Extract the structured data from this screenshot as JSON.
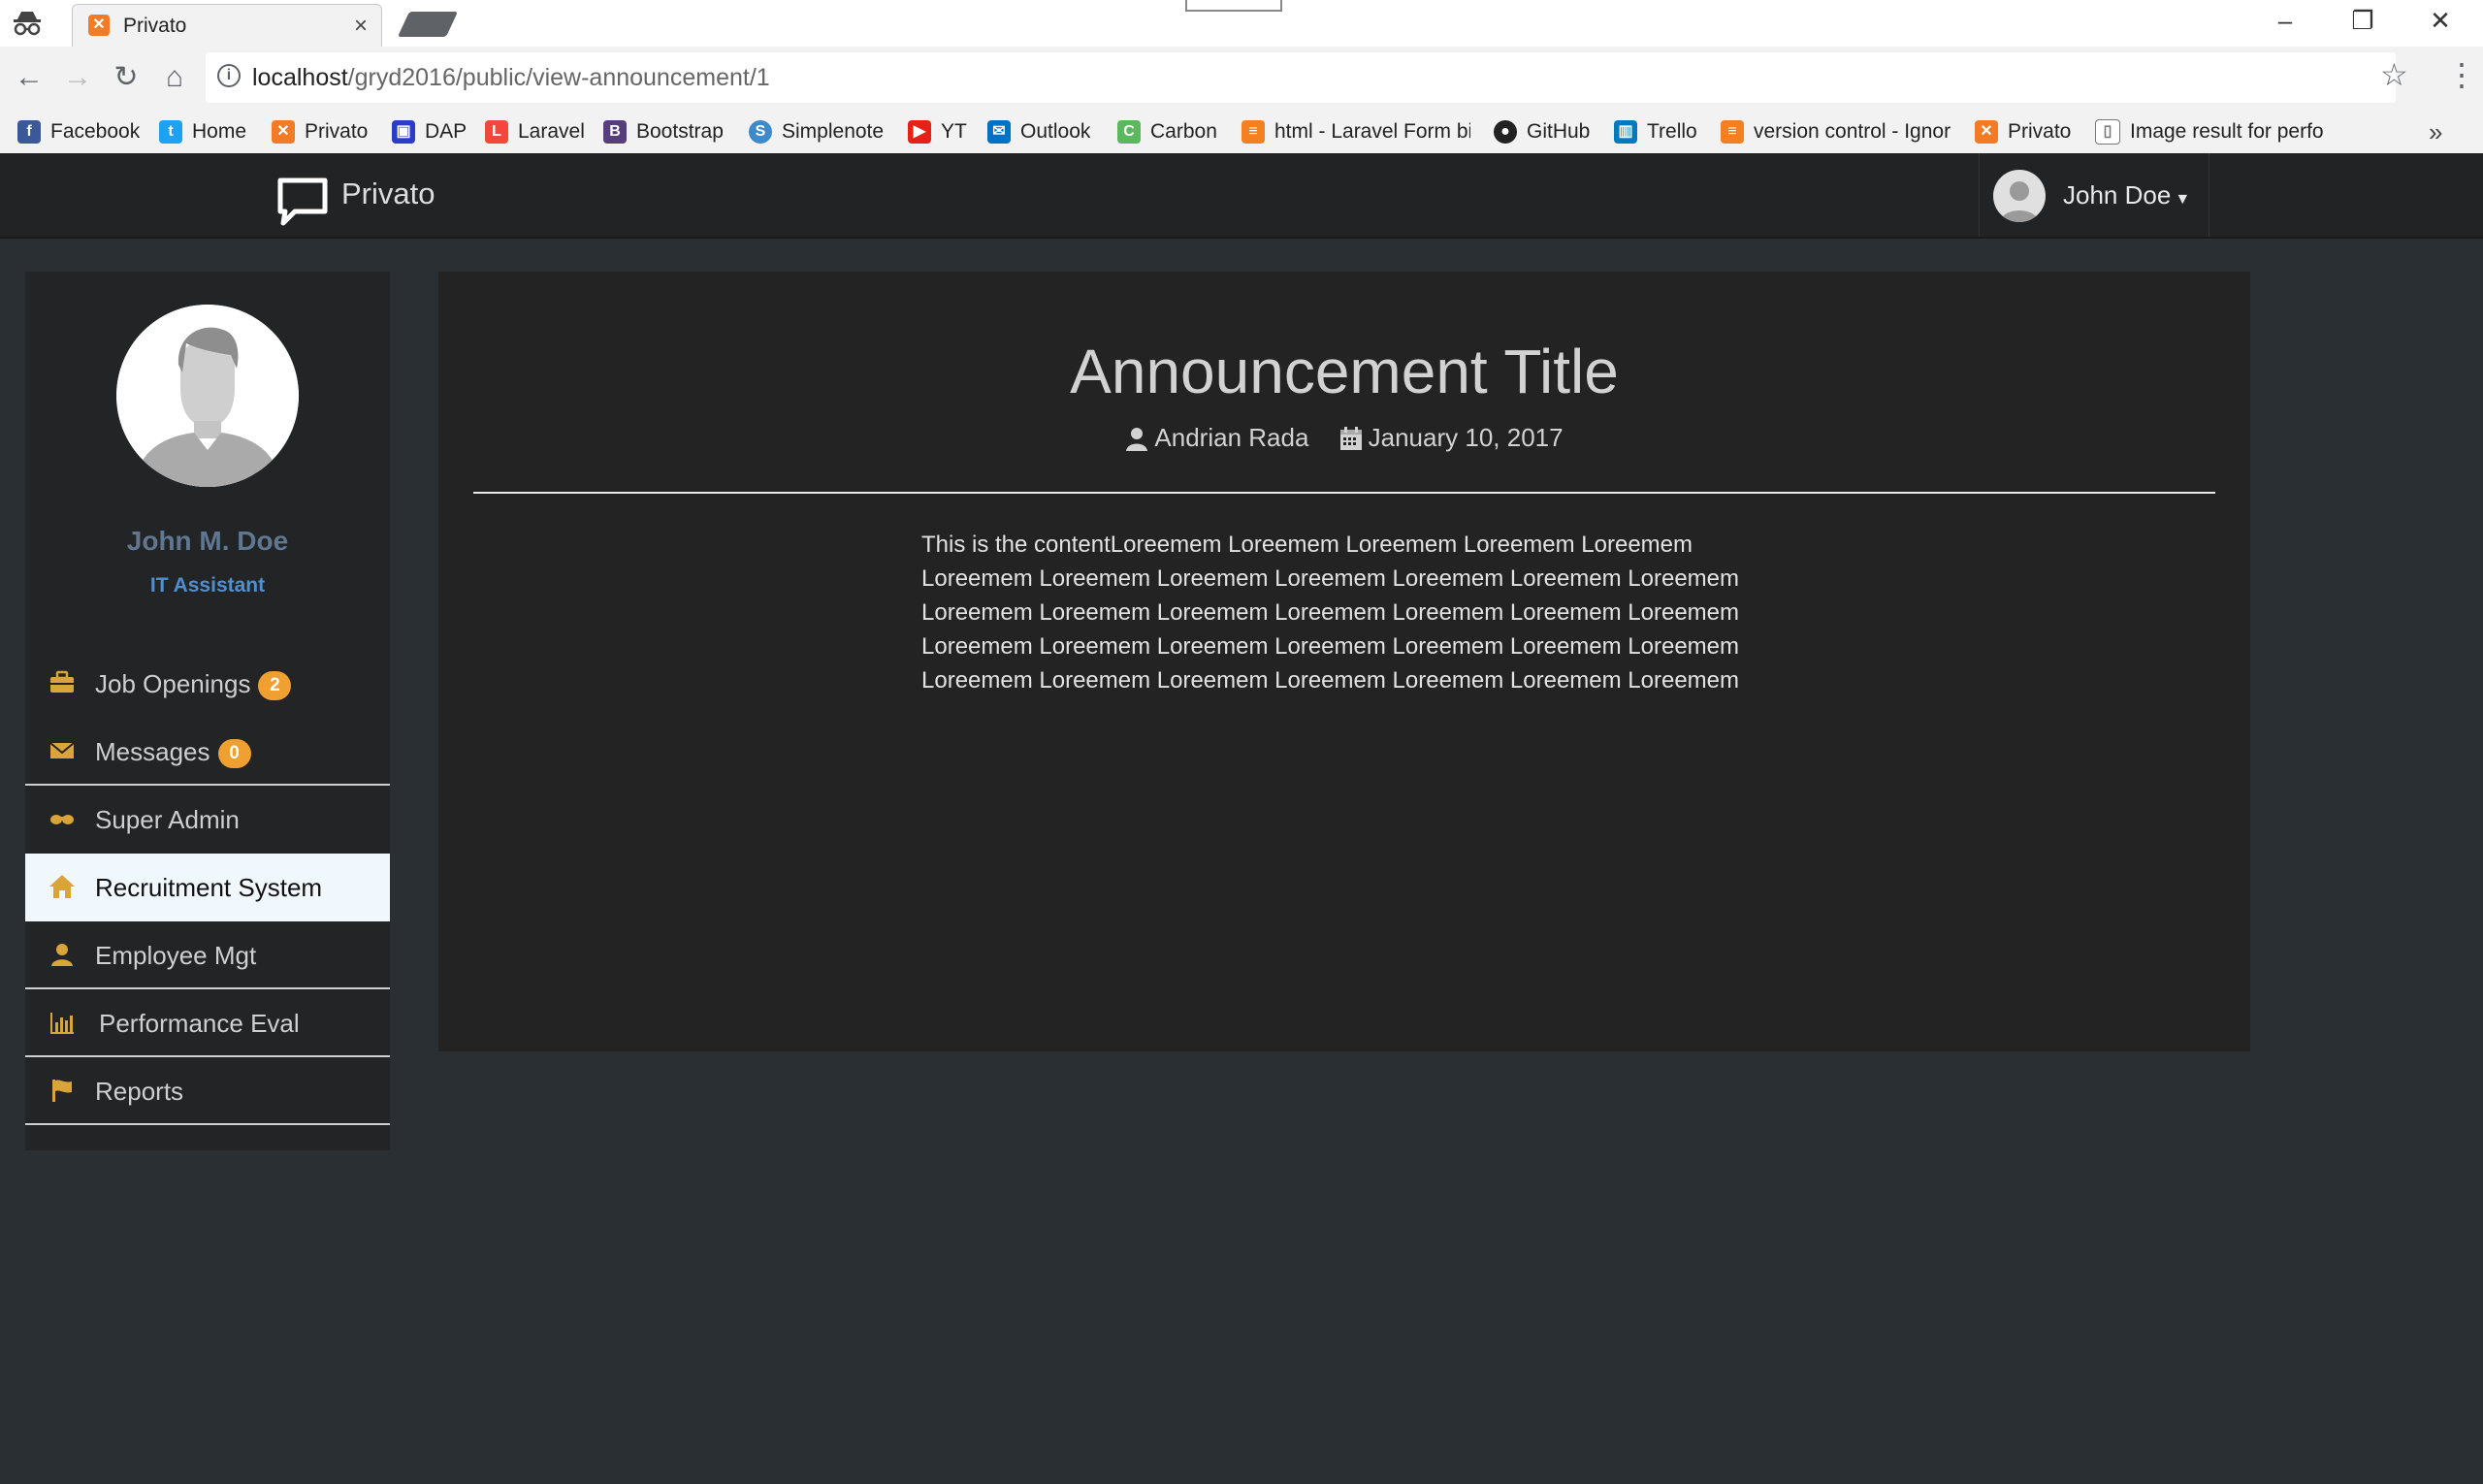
{
  "browser": {
    "tab_title": "Privato",
    "url_host": "localhost",
    "url_path": "/gryd2016/public/view-announcement/1",
    "bookmarks": [
      {
        "label": "Facebook",
        "icon": "facebook-icon",
        "color": "#3b5998"
      },
      {
        "label": "Home",
        "icon": "twitter-icon",
        "color": "#1da1f2"
      },
      {
        "label": "Privato",
        "icon": "privato-icon",
        "color": "#f47b25"
      },
      {
        "label": "DAP",
        "icon": "dap-icon",
        "color": "#2a3cc8"
      },
      {
        "label": "Laravel",
        "icon": "laravel-icon",
        "color": "#f4473b"
      },
      {
        "label": "Bootstrap",
        "icon": "bootstrap-icon",
        "color": "#563d7c"
      },
      {
        "label": "Simplenote",
        "icon": "simplenote-icon",
        "color": "#3d89c9"
      },
      {
        "label": "YT",
        "icon": "youtube-icon",
        "color": "#e62117"
      },
      {
        "label": "Outlook",
        "icon": "outlook-icon",
        "color": "#0072c6"
      },
      {
        "label": "Carbon",
        "icon": "carbon-icon",
        "color": "#5cb85c"
      },
      {
        "label": "html - Laravel Form bi",
        "icon": "stackoverflow-icon",
        "color": "#f48024"
      },
      {
        "label": "GitHub",
        "icon": "github-icon",
        "color": "#222222"
      },
      {
        "label": "Trello",
        "icon": "trello-icon",
        "color": "#0079bf"
      },
      {
        "label": "version control - Ignor",
        "icon": "stackoverflow-icon",
        "color": "#f48024"
      },
      {
        "label": "Privato",
        "icon": "privato-icon",
        "color": "#f47b25"
      },
      {
        "label": "Image result for perfo",
        "icon": "document-icon",
        "color": "#ffffff"
      }
    ],
    "more": "»"
  },
  "navbar": {
    "brand": "Privato",
    "user": "John Doe"
  },
  "sidebar": {
    "name": "John M. Doe",
    "role": "IT Assistant",
    "items": [
      {
        "label": "Job Openings",
        "badge": "2",
        "icon": "briefcase-icon"
      },
      {
        "label": "Messages",
        "badge": "0",
        "icon": "envelope-icon"
      },
      {
        "label": "Super Admin",
        "icon": "sunglasses-icon"
      },
      {
        "label": "Recruitment System",
        "icon": "home-icon",
        "active": true
      },
      {
        "label": "Employee Mgt",
        "icon": "user-icon"
      },
      {
        "label": "Performance Eval",
        "icon": "stats-icon"
      },
      {
        "label": "Reports",
        "icon": "flag-icon"
      }
    ],
    "icon_color": "#d9a43a"
  },
  "announcement": {
    "title": "Announcement Title",
    "author": "Andrian Rada",
    "date": "January 10, 2017",
    "lines": [
      "This is the contentLoreemem Loreemem Loreemem Loreemem Loreemem",
      "Loreemem Loreemem Loreemem Loreemem Loreemem Loreemem Loreemem",
      "Loreemem Loreemem Loreemem Loreemem Loreemem Loreemem Loreemem",
      "Loreemem Loreemem Loreemem Loreemem Loreemem Loreemem Loreemem",
      "Loreemem Loreemem Loreemem Loreemem Loreemem Loreemem Loreemem"
    ]
  }
}
